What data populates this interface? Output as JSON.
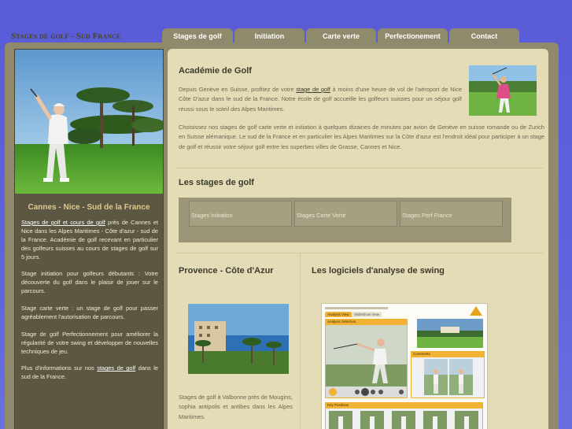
{
  "header": {
    "site_title": "Stages de golf - Sud France"
  },
  "nav": {
    "tabs": [
      {
        "label": "Stages de golf"
      },
      {
        "label": "Initiation"
      },
      {
        "label": "Carte verte"
      },
      {
        "label": "Perfectionement"
      },
      {
        "label": "Contact"
      }
    ]
  },
  "sidebar": {
    "heading": "Cannes - Nice - Sud de la France",
    "p1_link": "Stages de golf et cours de golf",
    "p1_rest": " près de Cannes et Nice dans les Alpes Maritimes - Côte d'azur - sud de la France. Académie de golf recevant en particulier des golfeurs suisses au cours de stages de golf sur 5 jours.",
    "p2": "Stage initiation pour golfeurs débutants : Votre découverte du golf dans le plaisir de jouer sur le parcours.",
    "p3": "Stage carte verte : un stage de golf pour passer agréablement l'autorisation de parcours.",
    "p4": "Stage de golf Perfectionnement pour améliorer la régularité de votre swing et développer de nouvelles techniques de jeu.",
    "p5_pre": "Plus d'informations sur nos ",
    "p5_link": "stages de golf",
    "p5_post": " dans le sud de la France."
  },
  "main": {
    "title": "Académie de Golf",
    "intro_pre": "Depuis Genève en Suisse, profitez de votre ",
    "intro_link": "stage de golf",
    "intro_post": " à moins d'une heure de vol de l'aéroport de Nice Côte D'azur dans le sud de la France. Notre école de golf accueille les golfeurs suisses pour un séjour golf réussi sous le soleil des Alpes Maritimes.",
    "para2": "Choisissez nos stages de golf carte verte et initiation à quelques dizaines de minutes par avion de Genève en suisse romande ou de Zurich en Suisse alémanique. Le sud de la France et en particulier les Alpes Maritimes sur la Côte d'azur est l'endroit idéal pour participer à un stage de golf et réussir votre séjour golf entre les superbes villes de Grasse, Cannes et Nice.",
    "stages_title": "Les stages de golf",
    "stages": [
      {
        "label": "Stages Initiation"
      },
      {
        "label": "Stages Carte Verte"
      },
      {
        "label": "Stages Perf France"
      }
    ],
    "provence_title": "Provence - Côte d'Azur",
    "provence_text": "Stages de golf à Valbonne près de Mougins, sophia antipolis et antibes dans les Alpes Maritimes.",
    "software_title": "Les logiciels d'analyse de swing",
    "software_panel": {
      "tab1": "Analysis View",
      "tab2": "SlideShow View",
      "section1": "Analysis Selection",
      "section2": "Comments",
      "section3": "Key Positions"
    }
  },
  "colors": {
    "background": "#5f63dc",
    "frame": "#8f8a6c",
    "sidebar": "#5b5743",
    "content": "#e4dcb6",
    "accent": "#e0c98c"
  }
}
